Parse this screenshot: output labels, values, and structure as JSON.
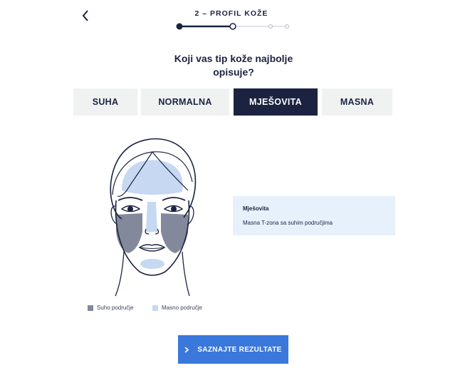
{
  "header": {
    "step_title": "2 – PROFIL KOŽE",
    "back_icon": "chevron-left-icon"
  },
  "progress": {
    "current_step": 2,
    "total_steps": 4
  },
  "question": {
    "line1": "Koji vas tip kože najbolje",
    "line2": "opisuje?"
  },
  "tabs": [
    {
      "label": "SUHA",
      "active": false
    },
    {
      "label": "NORMALNA",
      "active": false
    },
    {
      "label": "MJEŠOVITA",
      "active": true
    },
    {
      "label": "MASNA",
      "active": false
    }
  ],
  "info": {
    "title": "Mješovita",
    "description": "Masna T-zona sa suhim područjima"
  },
  "legend": [
    {
      "label": "Suho područje",
      "color": "#83889b"
    },
    {
      "label": "Masno područje",
      "color": "#c6d8f2"
    }
  ],
  "cta": {
    "label": "SAZNAJTE REZULTATE",
    "icon": "chevron-right-icon"
  },
  "colors": {
    "navy": "#1b2340",
    "accent": "#3a78db",
    "tab_bg": "#f0f2f2",
    "info_bg": "#e6f1fb"
  }
}
